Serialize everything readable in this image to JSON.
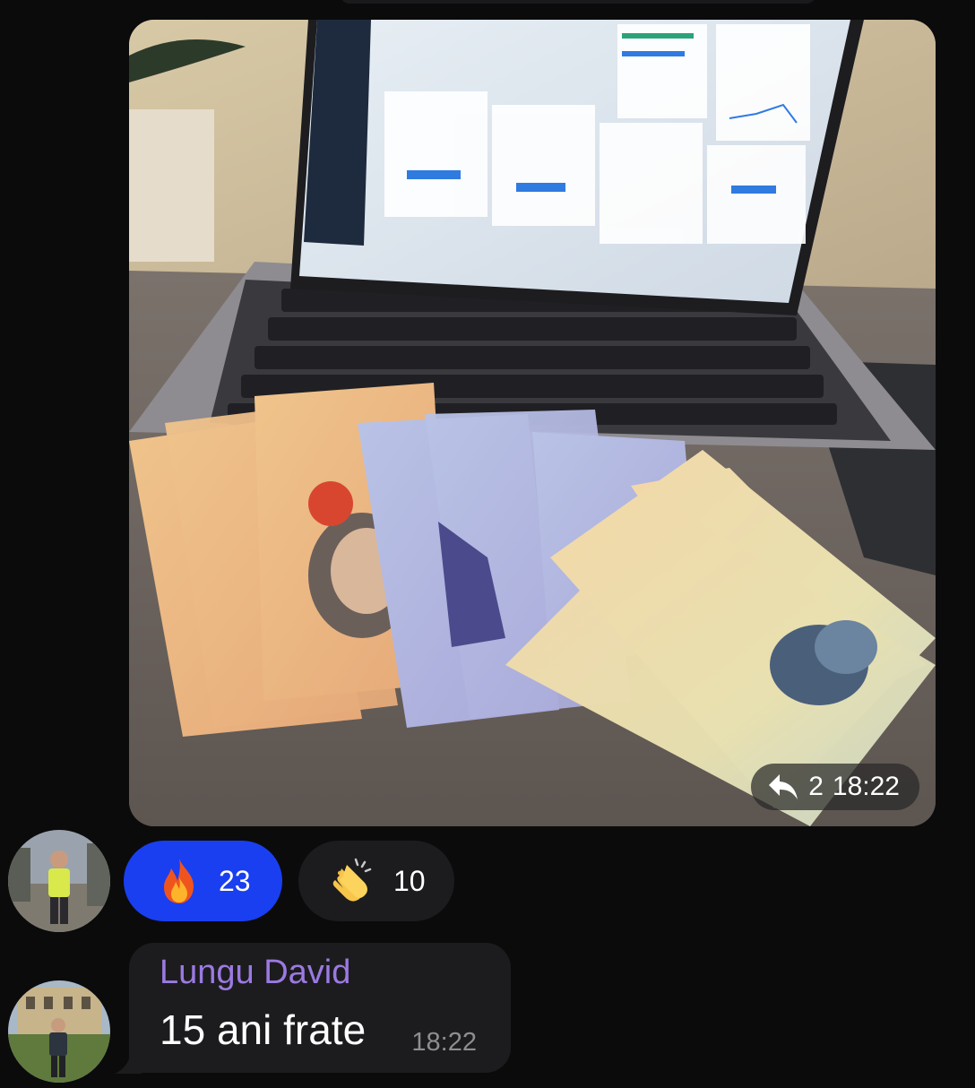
{
  "photo_message": {
    "forward_count": "2",
    "time": "18:22",
    "icons": {
      "reply": "reply-arrow-icon"
    }
  },
  "reactions": [
    {
      "emoji": "fire-emoji-icon",
      "count": "23",
      "color": "#1a3ff0",
      "active": true
    },
    {
      "emoji": "clapping-hands-emoji-icon",
      "count": "10",
      "color": "#1c1c1e",
      "active": false
    }
  ],
  "text_message": {
    "sender": "Lungu David",
    "text": "15 ani frate",
    "time": "18:22",
    "sender_color": "#9b7ae2"
  },
  "colors": {
    "background": "#0b0b0c",
    "bubble": "#1c1c1e",
    "accent": "#1a3ff0"
  }
}
